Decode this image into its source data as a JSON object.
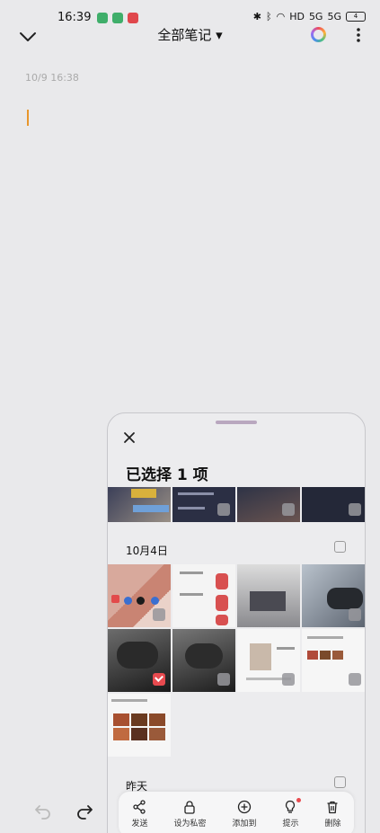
{
  "status": {
    "time": "16:39",
    "battery": "4",
    "hd": "HD",
    "signal": "5G",
    "signal2": "5G"
  },
  "header": {
    "title": "全部笔记 ▾"
  },
  "note": {
    "date": "10/9 16:38"
  },
  "sheet": {
    "title": "已选择 1 项",
    "sections": [
      {
        "label": "10月4日"
      },
      {
        "label": "昨天"
      }
    ],
    "toolbar": [
      {
        "label": "发送",
        "icon": "share-icon"
      },
      {
        "label": "设为私密",
        "icon": "lock-icon"
      },
      {
        "label": "添加到",
        "icon": "add-circle-icon"
      },
      {
        "label": "提示",
        "icon": "lightbulb-icon"
      },
      {
        "label": "删除",
        "icon": "trash-icon"
      }
    ]
  },
  "colors": {
    "accent": "#e84a4f",
    "cursor": "#e8962b"
  }
}
